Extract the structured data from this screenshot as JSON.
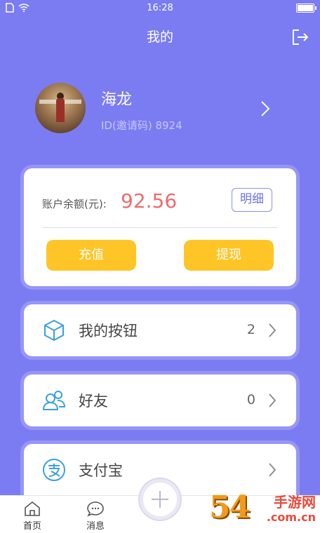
{
  "status_bar": {
    "time": "16:28",
    "battery_level": 0.9
  },
  "header": {
    "title": "我的"
  },
  "profile": {
    "name": "海龙",
    "id_text": "ID(邀请码) 8924"
  },
  "balance": {
    "label": "账户余额(元):",
    "value": "92.56",
    "detail_label": "明细",
    "recharge_label": "充值",
    "withdraw_label": "提现"
  },
  "menu": [
    {
      "label": "我的按钮",
      "count": "2",
      "icon": "cube-icon"
    },
    {
      "label": "好友",
      "count": "0",
      "icon": "friends-icon"
    },
    {
      "label": "支付宝",
      "count": "",
      "icon": "alipay-icon"
    }
  ],
  "tabbar": {
    "home_label": "首页",
    "messages_label": "消息"
  },
  "watermark": {
    "number": "54",
    "text_cn": "手游网",
    "url": ".com.cn"
  },
  "colors": {
    "background": "#7b7cf2",
    "accent_yellow": "#ffc526",
    "balance_red": "#ef6b6b"
  }
}
